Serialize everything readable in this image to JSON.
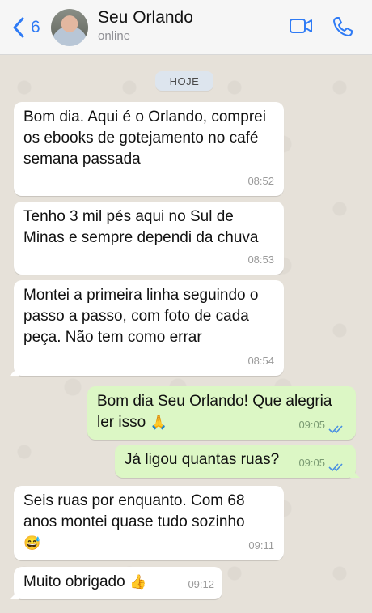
{
  "header": {
    "back_count": "6",
    "contact_name": "Seu Orlando",
    "status": "online"
  },
  "chat": {
    "day_label": "HOJE",
    "messages": [
      {
        "text": "Bom dia. Aqui é o Orlando, comprei os ebooks de gotejamento no café semana passada",
        "time": "08:52"
      },
      {
        "text": "Tenho 3 mil pés aqui no Sul de Minas e sempre dependi da chuva",
        "time": "08:53"
      },
      {
        "text": "Montei a primeira linha seguindo o passo a passo, com foto de cada peça. Não tem como errar",
        "time": "08:54"
      },
      {
        "text": "Bom dia Seu Orlando! Que alegria ler isso",
        "emoji": "🙏",
        "time": "09:05"
      },
      {
        "text": "Já ligou quantas ruas?",
        "time": "09:05"
      },
      {
        "text": "Seis ruas por enquanto. Com 68 anos montei quase tudo sozinho",
        "emoji": "😅",
        "time": "09:11"
      },
      {
        "text": "Muito obrigado",
        "emoji": "👍",
        "time": "09:12"
      }
    ]
  },
  "colors": {
    "accent": "#2f7bf5",
    "incoming_bubble": "#ffffff",
    "outgoing_bubble": "#dcf7c5",
    "read_ticks": "#4a90e2"
  },
  "icons": [
    "back-chevron-icon",
    "video-call-icon",
    "phone-call-icon",
    "double-check-icon"
  ]
}
